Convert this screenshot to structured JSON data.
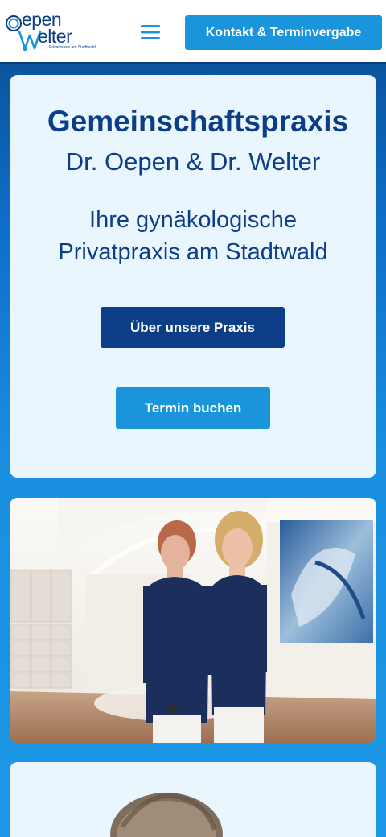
{
  "header": {
    "logo": {
      "word1": "epen",
      "word2": "elter",
      "tagline": "Privatpraxis am Stadtwald"
    },
    "menu_icon": "hamburger-menu-icon",
    "contact_label": "Kontakt & Terminvergabe"
  },
  "hero": {
    "title": "Gemeinschaftspraxis",
    "subtitle": "Dr. Oepen & Dr. Welter",
    "tagline_line1": "Ihre gynäkologische",
    "tagline_line2": "Privatpraxis am Stadtwald",
    "btn_praxis": "Über unsere Praxis",
    "btn_termin": "Termin buchen"
  },
  "colors": {
    "brand_dark": "#0b3e86",
    "brand_light": "#1a95dc",
    "card_bg": "#eaf6fd"
  }
}
